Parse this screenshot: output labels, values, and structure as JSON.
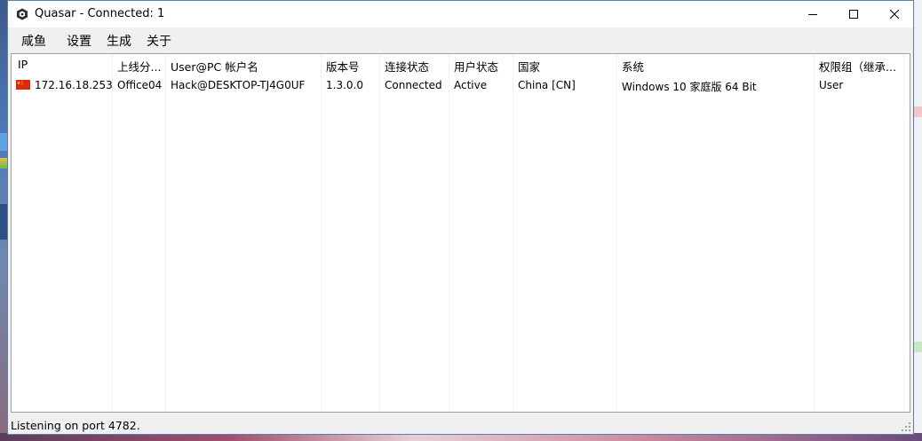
{
  "window": {
    "title": "Quasar - Connected: 1"
  },
  "menu": [
    "咸鱼",
    "设置",
    "生成",
    "关于"
  ],
  "columns": [
    "IP",
    "上线分...",
    "User@PC 帐户名",
    "版本号",
    "连接状态",
    "用户状态",
    "国家",
    "系统",
    "权限组（继承..."
  ],
  "rows": [
    {
      "flag": "cn-flag-icon",
      "ip": "172.16.18.253",
      "tag": "Office04",
      "user_pc": "Hack@DESKTOP-TJ4G0UF",
      "version": "1.3.0.0",
      "connection": "Connected",
      "user_status": "Active",
      "country": "China [CN]",
      "os": "Windows 10 家庭版 64 Bit",
      "account_type": "User"
    }
  ],
  "status": "Listening on port 4782.",
  "colors": {
    "window_border": "#5a7fb0",
    "flag_red": "#de2910",
    "flag_yellow": "#ffde00"
  }
}
